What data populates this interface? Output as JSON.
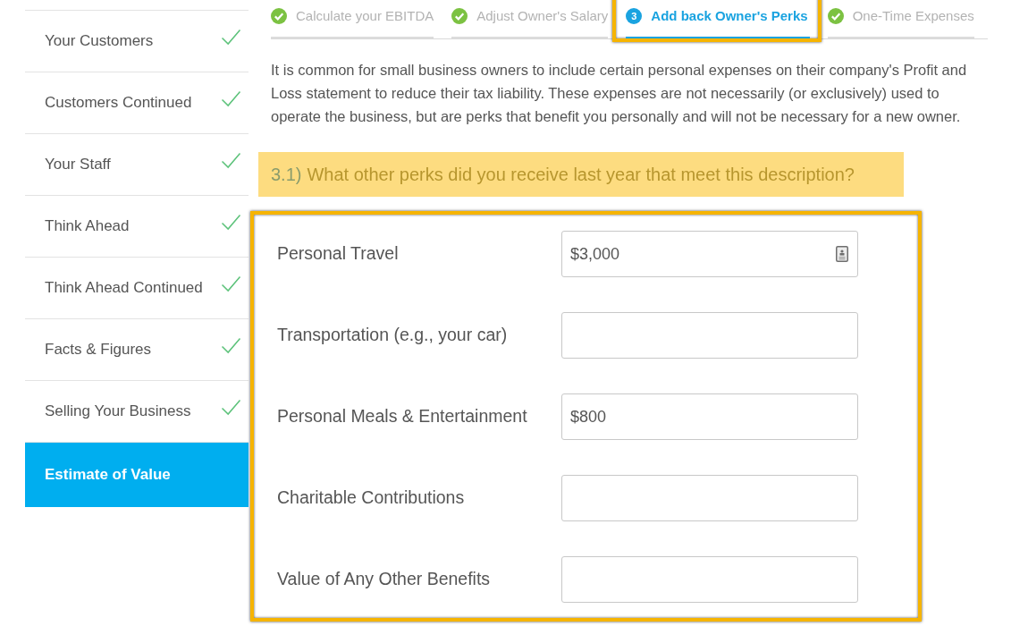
{
  "sidebar": {
    "items": [
      {
        "label": "Your Customers",
        "completed": true,
        "selected": false
      },
      {
        "label": "Customers Continued",
        "completed": true,
        "selected": false
      },
      {
        "label": "Your Staff",
        "completed": true,
        "selected": false
      },
      {
        "label": "Think Ahead",
        "completed": true,
        "selected": false
      },
      {
        "label": "Think Ahead Continued",
        "completed": true,
        "selected": false
      },
      {
        "label": "Facts & Figures",
        "completed": true,
        "selected": false
      },
      {
        "label": "Selling Your Business",
        "completed": true,
        "selected": false
      },
      {
        "label": "Estimate of Value",
        "completed": false,
        "selected": true
      }
    ]
  },
  "steps": [
    {
      "label": "Calculate your EBITDA",
      "completed": true,
      "selected": false,
      "highlighted": false
    },
    {
      "label": "Adjust Owner's Salary",
      "completed": true,
      "selected": false,
      "highlighted": false
    },
    {
      "label": "Add back Owner's Perks",
      "number": "3",
      "completed": false,
      "selected": true,
      "highlighted": true
    },
    {
      "label": "One-Time Expenses",
      "completed": true,
      "selected": false,
      "highlighted": false
    }
  ],
  "intro": "It is common for small business owners to include certain personal expenses on their company's Profit and Loss statement to reduce their tax liability. These expenses are not necessarily (or exclusively) used to operate the business, but are perks that benefit you personally and will not be necessary for a new owner.",
  "question": {
    "number": "3.1)",
    "text": "What other perks did you receive last year that meet this description?"
  },
  "form": {
    "highlighted": true,
    "fields": [
      {
        "label": "Personal Travel",
        "value": "$3,000",
        "autofill_icon": true
      },
      {
        "label": "Transportation (e.g., your car)",
        "autofill_icon": false
      },
      {
        "label": "Personal Meals & Entertainment",
        "value": "$800",
        "autofill_icon": false
      },
      {
        "label": "Charitable Contributions",
        "autofill_icon": false
      },
      {
        "label": "Value of Any Other Benefits",
        "autofill_icon": false
      }
    ]
  }
}
